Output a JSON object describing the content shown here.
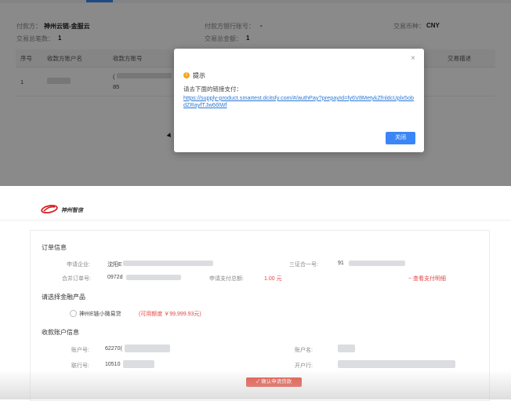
{
  "top": {
    "payer_label": "付款方：",
    "payer_value": "神州云链-金服云",
    "bank_label": "付款方银行账号：",
    "bank_value": "-",
    "currency_label": "交易币种：",
    "currency_value": "CNY",
    "count_label": "交易总笔数：",
    "count_value": "1",
    "amount_label": "交易总金额：",
    "amount_value": "1",
    "table": {
      "headers": [
        "序号",
        "收款方账户名",
        "收款方账号",
        "交易描述"
      ],
      "row": {
        "index": "1",
        "account_suffix_top": "(",
        "account_suffix_bottom": "85"
      }
    },
    "dialog": {
      "close": "×",
      "icon": "warning-icon",
      "icon_glyph": "!",
      "title": "提示",
      "message": "请去下面的链接支付：",
      "link": "https://supply-product.smartest.dcitsfy.com/#/authPay?prepayId=fy6V8MetykZfnldcUplx5obdZRayfTJw66lWf",
      "button": "关闭"
    }
  },
  "bottom": {
    "logo_text": "神州智信",
    "order_section": "订单信息",
    "applicant_label": "申请企业:",
    "applicant_value": "沈阳E",
    "credit_label": "三证合一号:",
    "credit_value": "91",
    "contract_label": "合并订单号:",
    "contract_value": "0972d",
    "amount_label": "申请支付总额:",
    "amount_value": "1.00 元",
    "detail_link": "查看支付明细",
    "product_section": "请选择金融产品",
    "product_name": "神州E链小微易贷",
    "product_limit": "(可用额度 ￥99,999.93元)",
    "payee_section": "收款账户信息",
    "acct_label": "账户号:",
    "acct_value": "62270(",
    "acct_name_label": "账户名:",
    "bank_no_label": "联行号:",
    "bank_no_value": "10510",
    "bank_name_label": "开户行:",
    "confirm_button": "确认申请贷款"
  },
  "colors": {
    "accent": "#3b86f7",
    "link": "#2b78d6",
    "warning": "#f5a623",
    "danger": "#e64545",
    "confirm": "#e8584a"
  }
}
